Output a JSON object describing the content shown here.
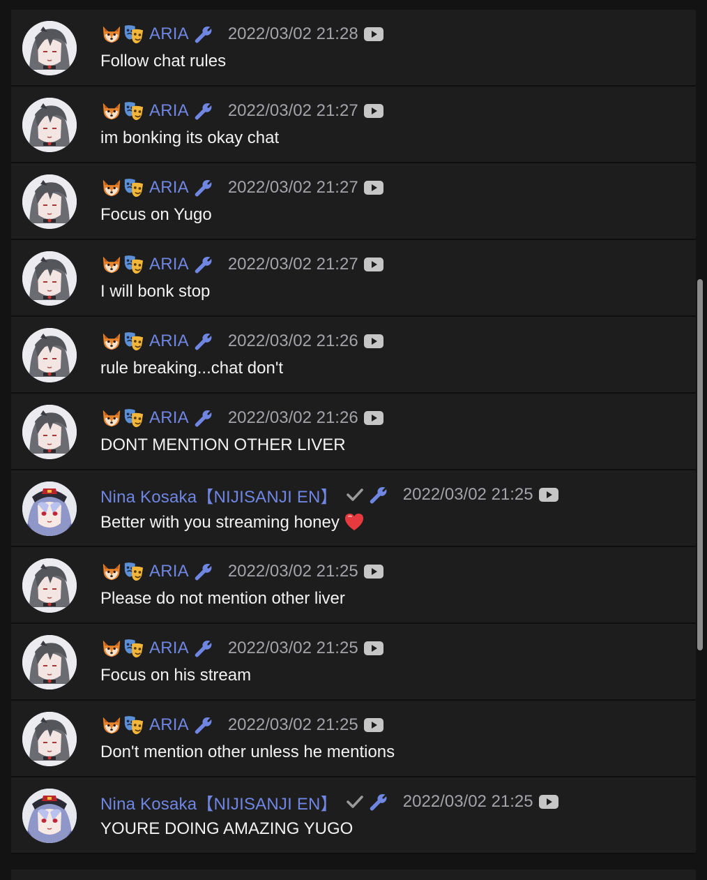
{
  "colors": {
    "background": "#131313",
    "card": "#1d1d1e",
    "author": "#6f86e2",
    "timestamp": "#a3a3a8",
    "text": "#f2f2f2"
  },
  "messages": [
    {
      "author": "ARIA",
      "type": "aria",
      "time": "2022/03/02 21:28",
      "text": "Follow chat rules"
    },
    {
      "author": "ARIA",
      "type": "aria",
      "time": "2022/03/02 21:27",
      "text": "im bonking its okay chat"
    },
    {
      "author": "ARIA",
      "type": "aria",
      "time": "2022/03/02 21:27",
      "text": "Focus on Yugo"
    },
    {
      "author": "ARIA",
      "type": "aria",
      "time": "2022/03/02 21:27",
      "text": "I will bonk stop"
    },
    {
      "author": "ARIA",
      "type": "aria",
      "time": "2022/03/02 21:26",
      "text": "rule breaking...chat don't"
    },
    {
      "author": "ARIA",
      "type": "aria",
      "time": "2022/03/02 21:26",
      "text": "DONT MENTION OTHER LIVER"
    },
    {
      "author": "Nina Kosaka【NIJISANJI EN】",
      "type": "nina",
      "time": "2022/03/02 21:25",
      "text": "Better with you streaming honey",
      "emoji": "heart"
    },
    {
      "author": "ARIA",
      "type": "aria",
      "time": "2022/03/02 21:25",
      "text": "Please do not mention other liver"
    },
    {
      "author": "ARIA",
      "type": "aria",
      "time": "2022/03/02 21:25",
      "text": "Focus on his stream"
    },
    {
      "author": "ARIA",
      "type": "aria",
      "time": "2022/03/02 21:25",
      "text": "Don't mention other unless he mentions"
    },
    {
      "author": "Nina Kosaka【NIJISANJI EN】",
      "type": "nina",
      "time": "2022/03/02 21:25",
      "text": "YOURE DOING AMAZING YUGO"
    }
  ]
}
